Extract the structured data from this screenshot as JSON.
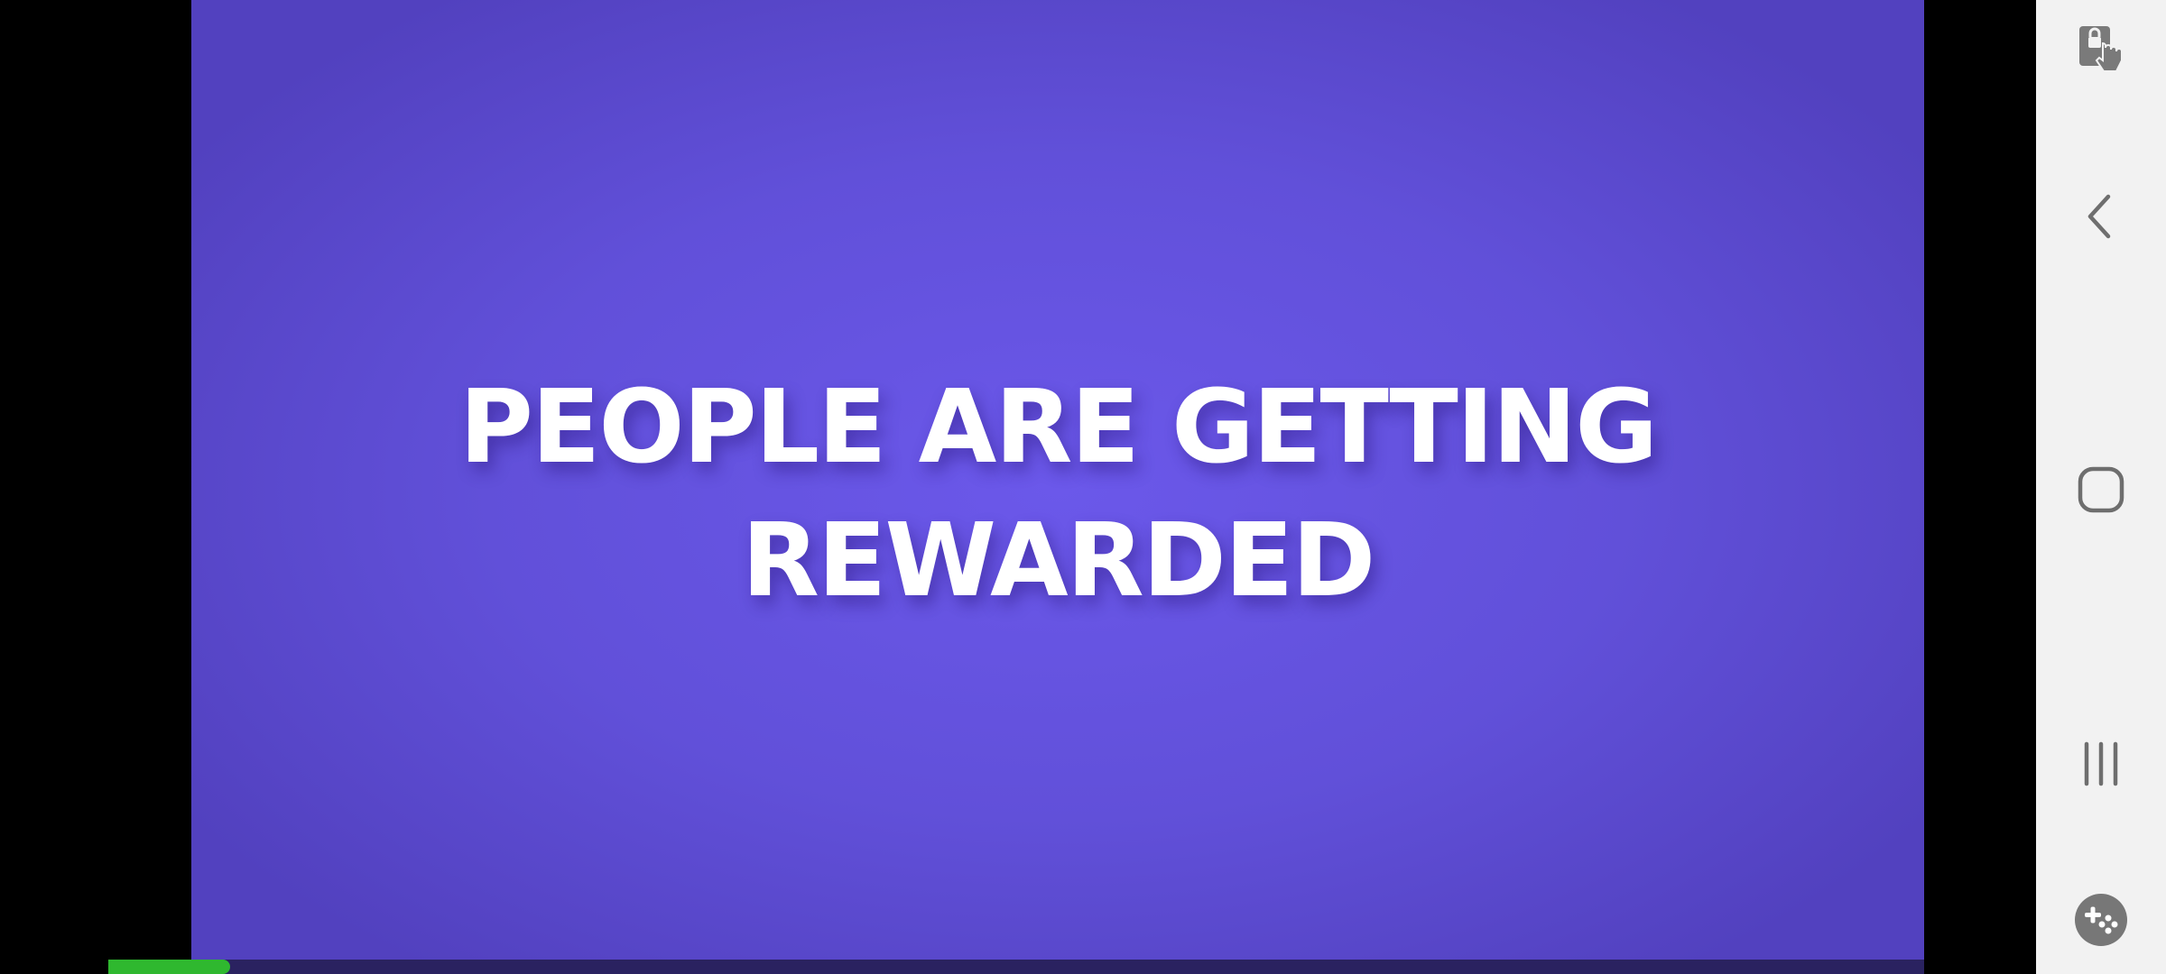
{
  "video": {
    "headline_line1": "PEOPLE ARE GETTING",
    "headline_line2": "REWARDED",
    "background_color": "#6356e4",
    "progress_percent": 6.7,
    "progress_color": "#2fb82f"
  },
  "nav_bar": {
    "buttons": [
      {
        "name": "screen-lock-touch-icon"
      },
      {
        "name": "back-icon"
      },
      {
        "name": "home-icon"
      },
      {
        "name": "recent-apps-icon"
      },
      {
        "name": "game-tools-icon"
      }
    ]
  }
}
